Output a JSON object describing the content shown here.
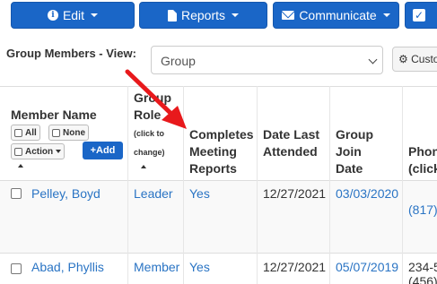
{
  "toolbar": {
    "edit_label": "Edit",
    "reports_label": "Reports",
    "communicate_label": "Communicate"
  },
  "view": {
    "label": "Group Members - View:",
    "selected": "Group",
    "custom_label": "Custo"
  },
  "headers": {
    "member_name": "Member Name",
    "group_role_1": "Group",
    "group_role_2": "Role",
    "group_role_hint_1": "(click to",
    "group_role_hint_2": "change)",
    "completes_1": "Completes",
    "completes_2": "Meeting",
    "completes_3": "Reports",
    "date_last_1": "Date Last",
    "date_last_2": "Attended",
    "join_1": "Group",
    "join_2": "Join",
    "join_3": "Date",
    "phone_1": "Phon",
    "phone_2": "(click"
  },
  "controls": {
    "all_label": "All",
    "none_label": "None",
    "action_label": "Action",
    "add_label": "+Add"
  },
  "rows": [
    {
      "name": "Pelley, Boyd",
      "role": "Leader",
      "completes": "Yes",
      "date_last": "12/27/2021",
      "join_date": "03/03/2020",
      "phone": "(817)"
    },
    {
      "name": "Abad, Phyllis",
      "role": "Member",
      "completes": "Yes",
      "date_last": "12/27/2021",
      "join_date": "05/07/2019",
      "phone": "234-5",
      "phone_2": "(456)"
    }
  ],
  "colors": {
    "primary": "#1a66c7",
    "link": "#2a74c4",
    "annotation_arrow": "#e8191c"
  }
}
